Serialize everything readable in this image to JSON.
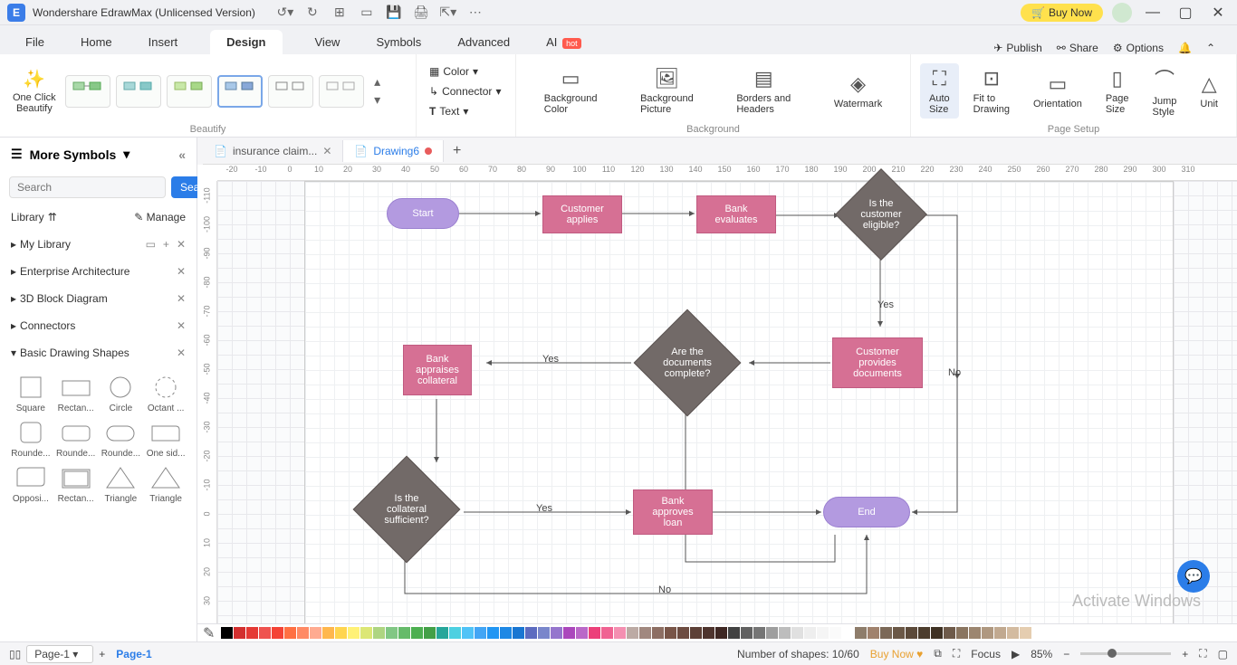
{
  "app": {
    "title": "Wondershare EdrawMax (Unlicensed Version)"
  },
  "title_actions": {
    "buy_now": "Buy Now"
  },
  "menu": {
    "items": [
      "File",
      "Home",
      "Insert",
      "Design",
      "View",
      "Symbols",
      "Advanced"
    ],
    "ai_label": "AI",
    "ai_tag": "hot",
    "active": "Design",
    "right": {
      "publish": "Publish",
      "share": "Share",
      "options": "Options"
    }
  },
  "ribbon": {
    "beautify": {
      "one_click": "One Click\nBeautify",
      "group_label": "Beautify"
    },
    "format": {
      "color": "Color",
      "connector": "Connector",
      "text": "Text"
    },
    "background": {
      "bg_color": "Background\nColor",
      "bg_picture": "Background\nPicture",
      "borders": "Borders and\nHeaders",
      "watermark": "Watermark",
      "group_label": "Background"
    },
    "page_setup": {
      "auto_size": "Auto\nSize",
      "fit_to": "Fit to\nDrawing",
      "orientation": "Orientation",
      "page_size": "Page\nSize",
      "jump_style": "Jump\nStyle",
      "unit": "Unit",
      "group_label": "Page Setup"
    }
  },
  "doc_tabs": {
    "tabs": [
      {
        "label": "insurance claim...",
        "active": false
      },
      {
        "label": "Drawing6",
        "active": true,
        "dirty": true
      }
    ]
  },
  "sidebar": {
    "title": "More Symbols",
    "search_placeholder": "Search",
    "search_btn": "Search",
    "library_label": "Library",
    "manage_label": "Manage",
    "sections": [
      "My Library",
      "Enterprise Architecture",
      "3D Block Diagram",
      "Connectors",
      "Basic Drawing Shapes"
    ],
    "shapes": [
      "Square",
      "Rectan...",
      "Circle",
      "Octant ...",
      "Rounde...",
      "Rounde...",
      "Rounde...",
      "One sid...",
      "Opposi...",
      "Rectan...",
      "Triangle",
      "Triangle"
    ]
  },
  "ruler_h": [
    "-20",
    "-10",
    "0",
    "10",
    "20",
    "30",
    "40",
    "50",
    "60",
    "70",
    "80",
    "90",
    "100",
    "110",
    "120",
    "130",
    "140",
    "150",
    "160",
    "170",
    "180",
    "190",
    "200",
    "210",
    "220",
    "230",
    "240",
    "250",
    "260",
    "270",
    "280",
    "290",
    "300",
    "310"
  ],
  "ruler_v": [
    "-110",
    "-100",
    "-90",
    "-80",
    "-70",
    "-60",
    "-50",
    "-40",
    "-30",
    "-20",
    "-10",
    "0",
    "10",
    "20",
    "30"
  ],
  "flowchart": {
    "start": "Start",
    "customer_applies": "Customer\napplies",
    "bank_evaluates": "Bank\nevaluates",
    "eligible": "Is the\ncustomer\neligible?",
    "provides_docs": "Customer\nprovides\ndocuments",
    "docs_complete": "Are the\ndocuments\ncomplete?",
    "appraises": "Bank\nappraises\ncollateral",
    "collateral": "Is the\ncollateral\nsufficient?",
    "approves": "Bank\napproves\nloan",
    "end": "End",
    "yes": "Yes",
    "no": "No"
  },
  "colors": [
    "#000000",
    "#d32f2f",
    "#e53935",
    "#ef5350",
    "#f44336",
    "#ff7043",
    "#ff8a65",
    "#ffab91",
    "#ffb74d",
    "#ffd54f",
    "#fff176",
    "#dce775",
    "#aed581",
    "#81c784",
    "#66bb6a",
    "#4caf50",
    "#43a047",
    "#26a69a",
    "#4dd0e1",
    "#4fc3f7",
    "#42a5f5",
    "#2196f3",
    "#1e88e5",
    "#1976d2",
    "#5c6bc0",
    "#7986cb",
    "#9575cd",
    "#ab47bc",
    "#ba68c8",
    "#ec407a",
    "#f06292",
    "#f48fb1",
    "#bcaaa4",
    "#a1887f",
    "#8d6e63",
    "#795548",
    "#6d4c41",
    "#5d4037",
    "#4e342e",
    "#3e2723",
    "#424242",
    "#616161",
    "#757575",
    "#9e9e9e",
    "#bdbdbd",
    "#e0e0e0",
    "#eeeeee",
    "#f5f5f5",
    "#fafafa",
    "#ffffff",
    "#8e7d6b",
    "#a0826d",
    "#7b6857",
    "#6b5847",
    "#5c4a3a",
    "#4d3d2e",
    "#3f3124",
    "#6e5a4a",
    "#8a7560",
    "#9c8670",
    "#af9880",
    "#c1a990",
    "#d3bba0",
    "#e5cdb0"
  ],
  "status": {
    "pages_btn": "Page-1",
    "page_label": "Page-1",
    "shapes_count": "Number of shapes: 10/60",
    "buy_now": "Buy Now",
    "focus": "Focus",
    "zoom": "85%"
  },
  "watermark": "Activate Windows"
}
